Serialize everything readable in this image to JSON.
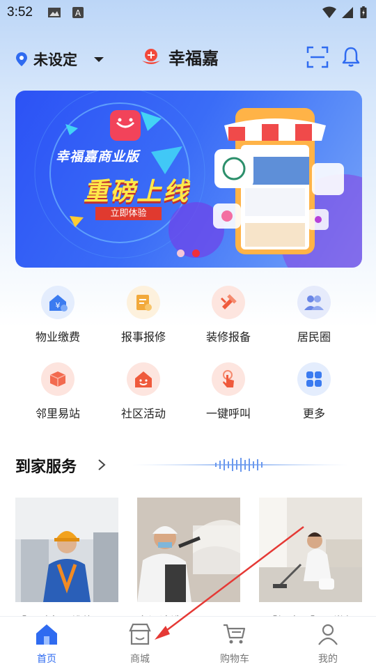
{
  "status_bar": {
    "time": "3:52"
  },
  "header": {
    "location_label": "未设定",
    "brand_name": "幸福嘉"
  },
  "banner": {
    "subtitle": "幸福嘉商业版",
    "title": "重磅上线",
    "cta": "立即体验",
    "slide_count": 2,
    "active_slide": 2
  },
  "services": [
    {
      "label": "物业缴费",
      "icon": "property-fee-icon",
      "color": "#3b7bf0",
      "bg": "#e4edfd"
    },
    {
      "label": "报事报修",
      "icon": "repair-report-icon",
      "color": "#f2a93b",
      "bg": "#fdf1dd"
    },
    {
      "label": "装修报备",
      "icon": "renovation-icon",
      "color": "#ef5a3c",
      "bg": "#fde5df"
    },
    {
      "label": "居民圈",
      "icon": "residents-icon",
      "color": "#6a86e6",
      "bg": "#e6ebfb"
    },
    {
      "label": "邻里易站",
      "icon": "box-icon",
      "color": "#f26a4f",
      "bg": "#fde4de"
    },
    {
      "label": "社区活动",
      "icon": "community-icon",
      "color": "#ef5a3c",
      "bg": "#fde5df"
    },
    {
      "label": "一键呼叫",
      "icon": "tap-call-icon",
      "color": "#ef5a3c",
      "bg": "#fde5df"
    },
    {
      "label": "更多",
      "icon": "more-grid-icon",
      "color": "#3b7bf0",
      "bg": "#e4edfd"
    }
  ],
  "section": {
    "title": "到家服务"
  },
  "cards": [
    {
      "title": "【限时名…维修",
      "image": "technician-photo"
    },
    {
      "title": "空调清洗",
      "image": "ac-cleaning-photo"
    },
    {
      "title": "【加班…】日常保",
      "image": "cleaning-photo"
    }
  ],
  "tabbar": {
    "tabs": [
      {
        "label": "首页",
        "icon": "home-icon",
        "active": true
      },
      {
        "label": "商城",
        "icon": "shop-icon",
        "active": false
      },
      {
        "label": "购物车",
        "icon": "cart-icon",
        "active": false
      },
      {
        "label": "我的",
        "icon": "user-icon",
        "active": false
      }
    ]
  },
  "colors": {
    "accent": "#2f6bf0",
    "annotation_arrow": "#e53935"
  }
}
